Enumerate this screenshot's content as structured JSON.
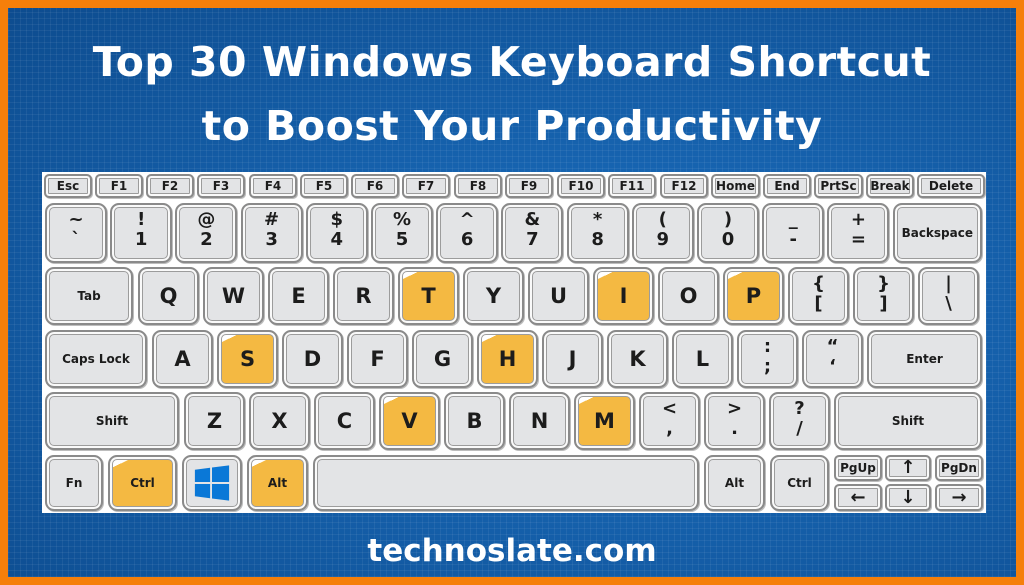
{
  "header": {
    "title_line1": "Top 30 Windows Keyboard Shortcut",
    "title_line2": "to Boost Your Productivity"
  },
  "footer": {
    "site": "technoslate.com"
  },
  "colors": {
    "border_orange": "#f57f0a",
    "background_blue": "#1560ab",
    "highlight_yellow": "#f4b942",
    "key_gray": "#e3e4e6",
    "windows_logo_blue": "#0a78d7"
  },
  "keyboard": {
    "function_row": [
      "Esc",
      "F1",
      "F2",
      "F3",
      "F4",
      "F5",
      "F6",
      "F7",
      "F8",
      "F9",
      "F10",
      "F11",
      "F12",
      "Home",
      "End",
      "PrtSc",
      "Break",
      "Delete"
    ],
    "number_row": [
      {
        "top": "~",
        "bottom": "`"
      },
      {
        "top": "!",
        "bottom": "1"
      },
      {
        "top": "@",
        "bottom": "2"
      },
      {
        "top": "#",
        "bottom": "3"
      },
      {
        "top": "$",
        "bottom": "4"
      },
      {
        "top": "%",
        "bottom": "5"
      },
      {
        "top": "^",
        "bottom": "6"
      },
      {
        "top": "&",
        "bottom": "7"
      },
      {
        "top": "*",
        "bottom": "8"
      },
      {
        "top": "(",
        "bottom": "9"
      },
      {
        "top": ")",
        "bottom": "0"
      },
      {
        "top": "_",
        "bottom": "-"
      },
      {
        "top": "+",
        "bottom": "="
      }
    ],
    "backspace": "Backspace",
    "tab": "Tab",
    "qwerty_row": [
      "Q",
      "W",
      "E",
      "R",
      "T",
      "Y",
      "U",
      "I",
      "O",
      "P"
    ],
    "bracket_keys": [
      {
        "top": "{",
        "bottom": "["
      },
      {
        "top": "}",
        "bottom": "]"
      },
      {
        "top": "|",
        "bottom": "\\"
      }
    ],
    "caps_lock": "Caps Lock",
    "home_row": [
      "A",
      "S",
      "D",
      "F",
      "G",
      "H",
      "J",
      "K",
      "L"
    ],
    "punct_home": [
      {
        "top": ":",
        "bottom": ";"
      },
      {
        "top": "“",
        "bottom": "‘"
      }
    ],
    "enter": "Enter",
    "shift_left": "Shift",
    "bottom_letters": [
      "Z",
      "X",
      "C",
      "V",
      "B",
      "N",
      "M"
    ],
    "punct_bottom": [
      {
        "top": "<",
        "bottom": ","
      },
      {
        "top": ">",
        "bottom": "."
      },
      {
        "top": "?",
        "bottom": "/"
      }
    ],
    "shift_right": "Shift",
    "fn": "Fn",
    "ctrl_left": "Ctrl",
    "win_icon": "windows-logo-icon",
    "alt_left": "Alt",
    "alt_right": "Alt",
    "ctrl_right": "Ctrl",
    "pgup": "PgUp",
    "pgdn": "PgDn",
    "arrow_up": "↑",
    "arrow_down": "↓",
    "arrow_left": "←",
    "arrow_right": "→",
    "highlighted_keys": [
      "T",
      "I",
      "P",
      "S",
      "H",
      "V",
      "M",
      "Ctrl",
      "Alt"
    ]
  }
}
